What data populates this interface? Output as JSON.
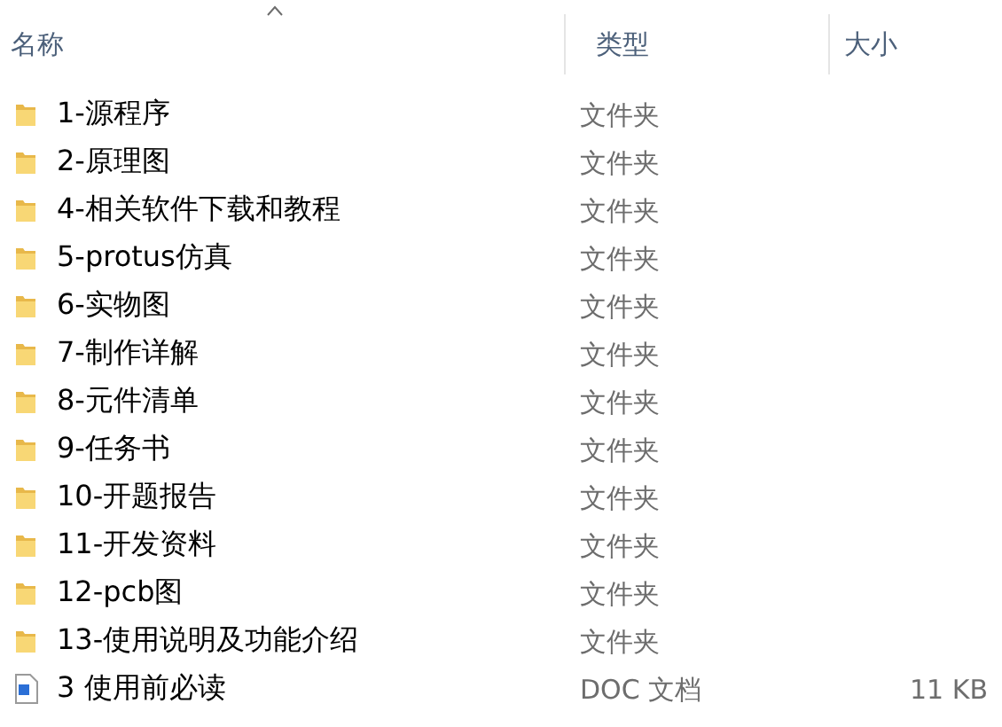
{
  "columns": [
    {
      "label": "名称",
      "sorted": true
    },
    {
      "label": "类型",
      "sorted": false
    },
    {
      "label": "大小",
      "sorted": false
    }
  ],
  "rows": [
    {
      "kind": "folder",
      "name": "1-源程序",
      "type": "文件夹"
    },
    {
      "kind": "folder",
      "name": "2-原理图",
      "type": "文件夹"
    },
    {
      "kind": "folder",
      "name": "4-相关软件下载和教程",
      "type": "文件夹"
    },
    {
      "kind": "folder",
      "name": "5-protus仿真",
      "type": "文件夹"
    },
    {
      "kind": "folder",
      "name": "6-实物图",
      "type": "文件夹"
    },
    {
      "kind": "folder",
      "name": "7-制作详解",
      "type": "文件夹"
    },
    {
      "kind": "folder",
      "name": "8-元件清单",
      "type": "文件夹"
    },
    {
      "kind": "folder",
      "name": "9-任务书",
      "type": "文件夹"
    },
    {
      "kind": "folder",
      "name": "10-开题报告",
      "type": "文件夹"
    },
    {
      "kind": "folder",
      "name": "11-开发资料",
      "type": "文件夹"
    },
    {
      "kind": "folder",
      "name": "12-pcb图",
      "type": "文件夹"
    },
    {
      "kind": "folder",
      "name": "13-使用说明及功能介绍",
      "type": "文件夹"
    },
    {
      "kind": "doc",
      "name": "3 使用前必读",
      "type": "DOC 文档",
      "size": "11 KB"
    }
  ]
}
